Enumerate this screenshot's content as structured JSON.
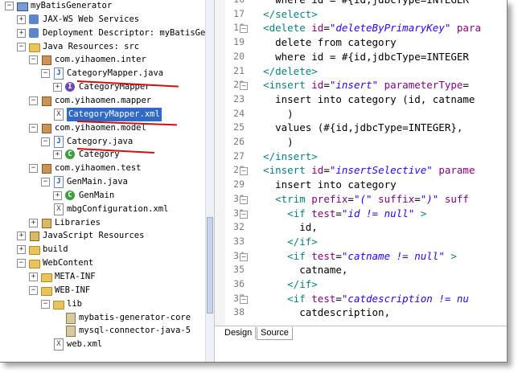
{
  "tree": [
    {
      "label": "myBatisGenerator",
      "icon": "project",
      "toggle": "−"
    },
    {
      "label": "JAX-WS Web Services",
      "icon": "ws",
      "toggle": "+"
    },
    {
      "label": "Deployment Descriptor: myBatisGe",
      "icon": "ws",
      "toggle": "+"
    },
    {
      "label": "Java Resources: src",
      "icon": "folder",
      "toggle": "−"
    },
    {
      "label": "com.yihaomen.inter",
      "icon": "package",
      "toggle": "−"
    },
    {
      "label": "CategoryMapper.java",
      "icon": "javafile",
      "toggle": "−"
    },
    {
      "label": "CategoryMapper",
      "icon": "iface",
      "toggle": "+"
    },
    {
      "label": "com.yihaomen.mapper",
      "icon": "package",
      "toggle": "−"
    },
    {
      "label": "CategoryMapper.xml",
      "icon": "xmlfile",
      "toggle": ""
    },
    {
      "label": "com.yihaomen.model",
      "icon": "package",
      "toggle": "−"
    },
    {
      "label": "Category.java",
      "icon": "javafile",
      "toggle": "−"
    },
    {
      "label": "Category",
      "icon": "cls",
      "toggle": "+"
    },
    {
      "label": "com.yihaomen.test",
      "icon": "package",
      "toggle": "−"
    },
    {
      "label": "GenMain.java",
      "icon": "javafile",
      "toggle": "−"
    },
    {
      "label": "GenMain",
      "icon": "cls",
      "toggle": "+"
    },
    {
      "label": "mbgConfiguration.xml",
      "icon": "xmlfile",
      "toggle": ""
    },
    {
      "label": "Libraries",
      "icon": "lib",
      "toggle": "+"
    },
    {
      "label": "JavaScript Resources",
      "icon": "lib",
      "toggle": "+"
    },
    {
      "label": "build",
      "icon": "folder",
      "toggle": "+"
    },
    {
      "label": "WebContent",
      "icon": "folder",
      "toggle": "−"
    },
    {
      "label": "META-INF",
      "icon": "folder",
      "toggle": "+"
    },
    {
      "label": "WEB-INF",
      "icon": "folder",
      "toggle": "−"
    },
    {
      "label": "lib",
      "icon": "folder",
      "toggle": "−"
    },
    {
      "label": "mybatis-generator-core",
      "icon": "jar",
      "toggle": ""
    },
    {
      "label": "mysql-connector-java-5",
      "icon": "jar",
      "toggle": ""
    },
    {
      "label": "web.xml",
      "icon": "xmlfile",
      "toggle": ""
    }
  ],
  "editor": {
    "line_numbers": [
      "16",
      "17",
      "18",
      "19",
      "20",
      "21",
      "22",
      "23",
      "24",
      "25",
      "26",
      "27",
      "28",
      "29",
      "30",
      "31",
      "32",
      "33",
      "34",
      "35",
      "36",
      "37",
      "38"
    ],
    "lines": [
      [
        [
          "plain",
          "    where id = #{id,jdbcType=INTEGER"
        ]
      ],
      [
        [
          "tag",
          "  </select>"
        ]
      ],
      [
        [
          "tag",
          "  <delete "
        ],
        [
          "attr",
          "id"
        ],
        [
          "plain",
          "="
        ],
        [
          "val",
          "\"deleteByPrimaryKey\""
        ],
        [
          "attr",
          " para"
        ]
      ],
      [
        [
          "plain",
          "    delete from category"
        ]
      ],
      [
        [
          "plain",
          "    where id = #{id,jdbcType=INTEGER"
        ]
      ],
      [
        [
          "tag",
          "  </delete>"
        ]
      ],
      [
        [
          "tag",
          "  <insert "
        ],
        [
          "attr",
          "id"
        ],
        [
          "plain",
          "="
        ],
        [
          "val",
          "\"insert\""
        ],
        [
          "attr",
          " parameterType"
        ],
        [
          "plain",
          "="
        ]
      ],
      [
        [
          "plain",
          "    insert into category (id, catname"
        ]
      ],
      [
        [
          "plain",
          "      )"
        ]
      ],
      [
        [
          "plain",
          "    values (#{id,jdbcType=INTEGER},"
        ]
      ],
      [
        [
          "plain",
          "      )"
        ]
      ],
      [
        [
          "tag",
          "  </insert>"
        ]
      ],
      [
        [
          "tag",
          "  <insert "
        ],
        [
          "attr",
          "id"
        ],
        [
          "plain",
          "="
        ],
        [
          "val",
          "\"insertSelective\""
        ],
        [
          "attr",
          " parame"
        ]
      ],
      [
        [
          "plain",
          "    insert into category"
        ]
      ],
      [
        [
          "tag",
          "    <trim "
        ],
        [
          "attr",
          "prefix"
        ],
        [
          "plain",
          "="
        ],
        [
          "val",
          "\"(\""
        ],
        [
          "attr",
          " suffix"
        ],
        [
          "plain",
          "="
        ],
        [
          "val",
          "\")\""
        ],
        [
          "attr",
          " suff"
        ]
      ],
      [
        [
          "tag",
          "      <if "
        ],
        [
          "attr",
          "test"
        ],
        [
          "plain",
          "="
        ],
        [
          "val",
          "\"id != null\""
        ],
        [
          "tag",
          " >"
        ]
      ],
      [
        [
          "plain",
          "        id,"
        ]
      ],
      [
        [
          "tag",
          "      </if>"
        ]
      ],
      [
        [
          "tag",
          "      <if "
        ],
        [
          "attr",
          "test"
        ],
        [
          "plain",
          "="
        ],
        [
          "val",
          "\"catname != null\""
        ],
        [
          "tag",
          " >"
        ]
      ],
      [
        [
          "plain",
          "        catname,"
        ]
      ],
      [
        [
          "tag",
          "      </if>"
        ]
      ],
      [
        [
          "tag",
          "      <if "
        ],
        [
          "attr",
          "test"
        ],
        [
          "plain",
          "="
        ],
        [
          "val",
          "\"catdescription != nu"
        ]
      ],
      [
        [
          "plain",
          "        catdescription,"
        ]
      ]
    ],
    "fold_markers": {
      "18": "−",
      "22": "−",
      "28": "−",
      "30": "−",
      "31": "−",
      "34": "−",
      "37": "−"
    }
  },
  "tabs": [
    "Design",
    "Source"
  ],
  "active_tab": "Source"
}
